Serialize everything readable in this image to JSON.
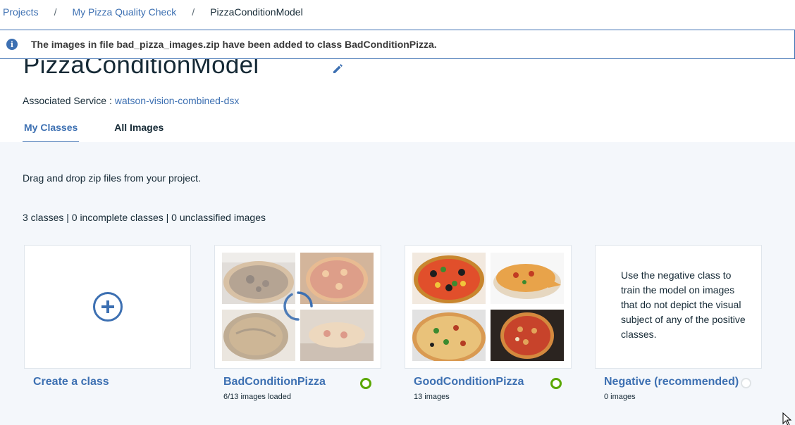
{
  "breadcrumb": {
    "items": [
      "Projects",
      "My Pizza Quality Check"
    ],
    "separator": "/",
    "current": "PizzaConditionModel"
  },
  "notification": {
    "icon": "info-icon",
    "message": "The images in file bad_pizza_images.zip have been added to class BadConditionPizza."
  },
  "model": {
    "title": "PizzaConditionModel",
    "associated_label": "Associated Service :",
    "associated_service": "watson-vision-combined-dsx"
  },
  "tabs": [
    {
      "label": "My Classes",
      "active": true
    },
    {
      "label": "All Images",
      "active": false
    }
  ],
  "content": {
    "drag_hint": "Drag and drop zip files from your project.",
    "stats": "3 classes | 0 incomplete classes | 0 unclassified images"
  },
  "classes": [
    {
      "title": "Create a class",
      "subtitle": "",
      "icon": "plus-circle-icon"
    },
    {
      "title": "BadConditionPizza",
      "subtitle": "6/13 images loaded",
      "status": "complete",
      "loading": true
    },
    {
      "title": "GoodConditionPizza",
      "subtitle": "13 images",
      "status": "complete",
      "loading": false
    },
    {
      "title": "Negative (recommended)",
      "subtitle": "0 images",
      "status": "empty",
      "description": "Use the negative class to train the model on images that do not depict the visual subject of any of the positive classes."
    }
  ],
  "colors": {
    "accent": "#3d70b2",
    "status_ok": "#5aa700",
    "content_bg": "#f4f7fb"
  }
}
